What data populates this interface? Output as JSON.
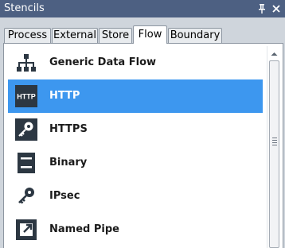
{
  "panel": {
    "title": "Stencils"
  },
  "tabs": [
    {
      "label": "Process",
      "active": false
    },
    {
      "label": "External",
      "active": false
    },
    {
      "label": "Store",
      "active": false
    },
    {
      "label": "Flow",
      "active": true
    },
    {
      "label": "Boundary",
      "active": false
    }
  ],
  "items": [
    {
      "label": "Generic Data Flow",
      "icon": "hierarchy-icon",
      "selected": false
    },
    {
      "label": "HTTP",
      "icon": "http-icon",
      "icon_text": "HTTP",
      "selected": true
    },
    {
      "label": "HTTPS",
      "icon": "key-icon",
      "selected": false
    },
    {
      "label": "Binary",
      "icon": "binary-icon",
      "selected": false
    },
    {
      "label": "IPsec",
      "icon": "key-icon",
      "selected": false
    },
    {
      "label": "Named Pipe",
      "icon": "pipe-icon",
      "selected": false
    }
  ],
  "colors": {
    "title_bar": "#4d6082",
    "selection": "#3d97ef",
    "icon": "#2c3742"
  }
}
